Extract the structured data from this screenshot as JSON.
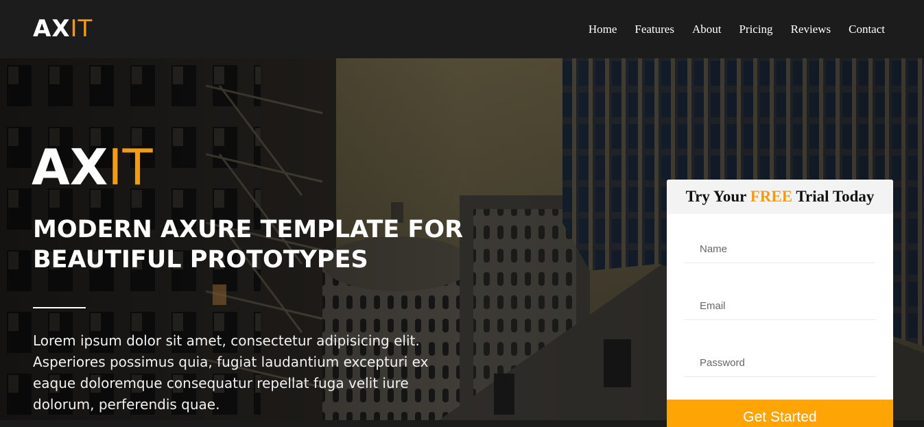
{
  "brand": {
    "logo_part1": "AX",
    "logo_part2": "IT"
  },
  "nav": {
    "items": [
      "Home",
      "Features",
      "About",
      "Pricing",
      "Reviews",
      "Contact"
    ]
  },
  "hero": {
    "logo_part1": "AX",
    "logo_part2": "IT",
    "headline_line1": "MODERN AXURE TEMPLATE FOR",
    "headline_line2": "BEAUTIFUL PROTOTYPES",
    "description": "Lorem ipsum dolor sit amet, consectetur adipisicing elit. Asperiores possimus quia, fugiat laudantium excepturi ex eaque doloremque consequatur repellat fuga velit iure dolorum, perferendis quae."
  },
  "signup": {
    "title_prefix": "Try Your ",
    "title_highlight": "FREE",
    "title_suffix": " Trial Today",
    "name_placeholder": "Name",
    "email_placeholder": "Email",
    "password_placeholder": "Password",
    "button_label": "Get Started"
  },
  "colors": {
    "accent": "#f39c12",
    "button": "#fea405",
    "navbar": "#1c1c1c"
  }
}
